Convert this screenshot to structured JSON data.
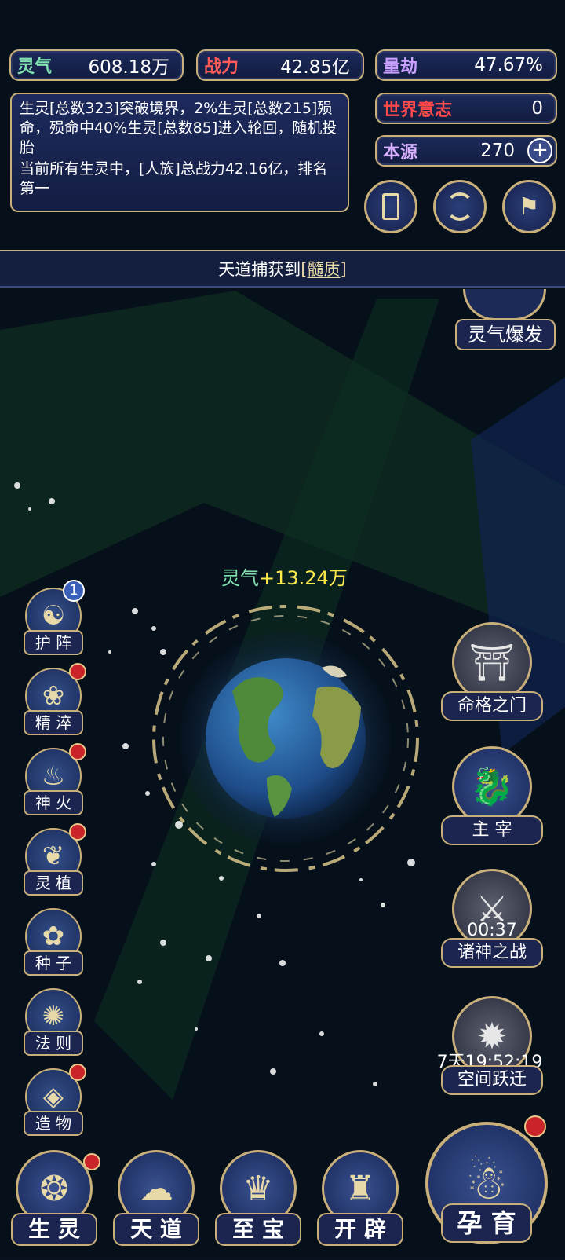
{
  "stats": {
    "lingqi": {
      "label": "灵气",
      "value": "608.18万",
      "color": "#7fe0b0"
    },
    "zhanli": {
      "label": "战力",
      "value": "42.85亿",
      "color": "#ff5a5a"
    },
    "liangjie": {
      "label": "量劫",
      "value": "47.67%",
      "color": "#c9a0ff"
    },
    "shijieyizhi": {
      "label": "世界意志",
      "value": "0",
      "color": "#ff4a4a"
    },
    "benyuan": {
      "label": "本源",
      "value": "270",
      "color": "#d9b3ff"
    }
  },
  "info_panel": {
    "line1": "生灵[总数323]突破境界，2%生灵[总数215]殒命，殒命中40%生灵[总数85]进入轮回，随机投胎",
    "line2": "当前所有生灵中，[人族]总战力42.16亿，排名第一"
  },
  "top_icons": [
    "card-icon",
    "vortex-icon",
    "flag-icon"
  ],
  "banner": {
    "prefix": "天道捕获到",
    "item": "[髓质]"
  },
  "lingqi_burst": {
    "label": "灵气爆发"
  },
  "gain": {
    "label": "灵气",
    "value": "+13.24万"
  },
  "left_menu": [
    {
      "label": "护 阵",
      "badge": "1",
      "icon": "taiji-icon"
    },
    {
      "label": "精 淬",
      "badge": "",
      "icon": "lotus-icon"
    },
    {
      "label": "神 火",
      "badge": "",
      "icon": "flame-icon"
    },
    {
      "label": "灵 植",
      "badge": "",
      "icon": "plant-icon"
    },
    {
      "label": "种 子",
      "badge": "",
      "icon": "flower-icon"
    },
    {
      "label": "法 则",
      "badge": "",
      "icon": "mask-icon"
    },
    {
      "label": "造 物",
      "badge": "",
      "icon": "diamond-icon"
    }
  ],
  "right_menu": [
    {
      "label": "命格之门",
      "timer": "",
      "icon": "gate-icon"
    },
    {
      "label": "主 宰",
      "timer": "",
      "icon": "dragon-icon"
    },
    {
      "label": "诸神之战",
      "timer": "00:37",
      "icon": "sword-icon"
    },
    {
      "label": "空间跃迁",
      "timer": "7天19:52:19",
      "icon": "portal-icon"
    }
  ],
  "bottom_nav": [
    {
      "label": "生 灵",
      "icon": "phoenix-icon"
    },
    {
      "label": "天 道",
      "icon": "cloud-icon"
    },
    {
      "label": "至 宝",
      "icon": "treasure-icon"
    },
    {
      "label": "开 辟",
      "icon": "crown-icon"
    },
    {
      "label": "孕 育",
      "icon": "embryo-icon"
    }
  ],
  "colors": {
    "gold": "#c9b07a",
    "panel": "#1b2550",
    "space": "#07101c",
    "gain": "#ffe84a"
  }
}
